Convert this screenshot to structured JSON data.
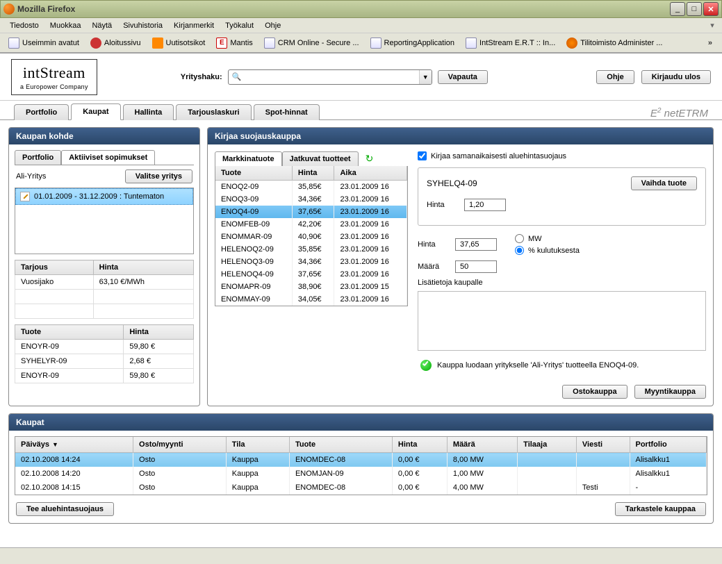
{
  "window": {
    "title": "Mozilla Firefox"
  },
  "menubar": [
    "Tiedosto",
    "Muokkaa",
    "Näytä",
    "Sivuhistoria",
    "Kirjanmerkit",
    "Työkalut",
    "Ohje"
  ],
  "bookmarks": [
    {
      "label": "Useimmin avatut",
      "icon": "doc"
    },
    {
      "label": "Aloitussivu",
      "icon": "red"
    },
    {
      "label": "Uutisotsikot",
      "icon": "rss"
    },
    {
      "label": "Mantis",
      "icon": "e"
    },
    {
      "label": "CRM Online - Secure ...",
      "icon": "doc"
    },
    {
      "label": "ReportingApplication",
      "icon": "doc"
    },
    {
      "label": "IntStream E.R.T :: In...",
      "icon": "doc"
    },
    {
      "label": "Tilitoimisto Administer ...",
      "icon": "spin"
    }
  ],
  "logo": {
    "name": "intStream",
    "sub": "a Europower Company"
  },
  "search": {
    "label": "Yrityshaku:",
    "placeholder": "",
    "value": "",
    "release_btn": "Vapauta"
  },
  "top_buttons": {
    "help": "Ohje",
    "logout": "Kirjaudu ulos"
  },
  "main_tabs": [
    "Portfolio",
    "Kaupat",
    "Hallinta",
    "Tarjouslaskuri",
    "Spot-hinnat"
  ],
  "main_tab_active": 1,
  "brand_suffix": "netETRM",
  "kaupan_kohde": {
    "title": "Kaupan kohde",
    "subtabs": [
      "Portfolio",
      "Aktiiviset sopimukset"
    ],
    "subtab_active": 1,
    "company": "Ali-Yritys",
    "choose_btn": "Valitse yritys",
    "contract_item": "01.01.2009 - 31.12.2009 : Tuntematon",
    "grid1": {
      "headers": [
        "Tarjous",
        "Hinta"
      ],
      "rows": [
        [
          "Vuosijako",
          "63,10 €/MWh"
        ]
      ]
    },
    "grid2": {
      "headers": [
        "Tuote",
        "Hinta"
      ],
      "rows": [
        [
          "ENOYR-09",
          "59,80 €"
        ],
        [
          "SYHELYR-09",
          "2,68 €"
        ],
        [
          "ENOYR-09",
          "59,80 €"
        ]
      ]
    }
  },
  "kirjaa": {
    "title": "Kirjaa suojauskauppa",
    "subtabs": [
      "Markkinatuote",
      "Jatkuvat tuotteet"
    ],
    "subtab_active": 0,
    "price_headers": [
      "Tuote",
      "Hinta",
      "Aika"
    ],
    "price_rows": [
      [
        "ENOQ2-09",
        "35,85€",
        "23.01.2009 16"
      ],
      [
        "ENOQ3-09",
        "34,36€",
        "23.01.2009 16"
      ],
      [
        "ENOQ4-09",
        "37,65€",
        "23.01.2009 16"
      ],
      [
        "ENOMFEB-09",
        "42,20€",
        "23.01.2009 16"
      ],
      [
        "ENOMMAR-09",
        "40,90€",
        "23.01.2009 16"
      ],
      [
        "HELENOQ2-09",
        "35,85€",
        "23.01.2009 16"
      ],
      [
        "HELENOQ3-09",
        "34,36€",
        "23.01.2009 16"
      ],
      [
        "HELENOQ4-09",
        "37,65€",
        "23.01.2009 16"
      ],
      [
        "ENOMAPR-09",
        "38,90€",
        "23.01.2009 15"
      ],
      [
        "ENOMMAY-09",
        "34,05€",
        "23.01.2009 16"
      ]
    ],
    "price_selected": 2,
    "checkbox_label": "Kirjaa samanaikaisesti aluehintasuojaus",
    "checkbox_checked": true,
    "product_name": "SYHELQ4-09",
    "change_product_btn": "Vaihda tuote",
    "hinta_label": "Hinta",
    "hinta1_value": "1,20",
    "hinta2_value": "37,65",
    "maara_label": "Määrä",
    "maara_value": "50",
    "unit_mw": "MW",
    "unit_pct": "% kulutuksesta",
    "unit_selected": "pct",
    "notes_label": "Lisätietoja kaupalle",
    "notes_value": "",
    "confirm_msg": "Kauppa luodaan yritykselle 'Ali-Yritys' tuotteella ENOQ4-09.",
    "buy_btn": "Ostokauppa",
    "sell_btn": "Myyntikauppa"
  },
  "kaupat": {
    "title": "Kaupat",
    "headers": [
      "Päiväys",
      "Osto/myynti",
      "Tila",
      "Tuote",
      "Hinta",
      "Määrä",
      "Tilaaja",
      "Viesti",
      "Portfolio"
    ],
    "rows": [
      [
        "02.10.2008 14:24",
        "Osto",
        "Kauppa",
        "ENOMDEC-08",
        "0,00 €",
        "8,00 MW",
        "",
        "",
        "Alisalkku1"
      ],
      [
        "02.10.2008 14:20",
        "Osto",
        "Kauppa",
        "ENOMJAN-09",
        "0,00 €",
        "1,00 MW",
        "",
        "",
        "Alisalkku1"
      ],
      [
        "02.10.2008 14:15",
        "Osto",
        "Kauppa",
        "ENOMDEC-08",
        "0,00 €",
        "4,00 MW",
        "",
        "Testi",
        "-"
      ]
    ],
    "selected": 0,
    "left_btn": "Tee aluehintasuojaus",
    "right_btn": "Tarkastele kauppaa"
  }
}
